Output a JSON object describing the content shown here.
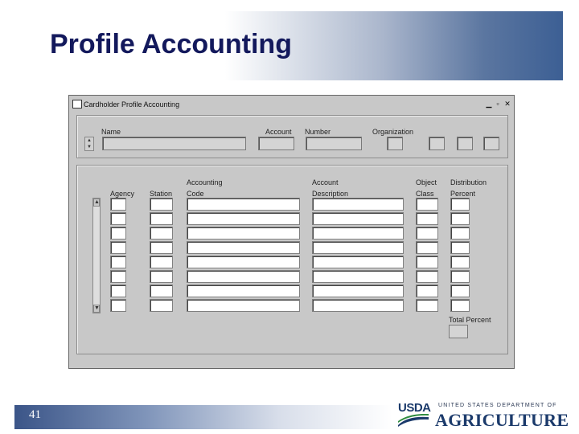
{
  "slide": {
    "title": "Profile Accounting",
    "page_number": "41",
    "footer": {
      "usda_mark": "USDA",
      "department": "UNITED STATES DEPARTMENT OF",
      "agriculture": "AGRICULTURE"
    }
  },
  "window": {
    "title": "Cardholder Profile Accounting",
    "controls": [
      "minimize",
      "maximize",
      "close"
    ]
  },
  "header_panel": {
    "labels": {
      "name": "Name",
      "account": "Account",
      "number": "Number",
      "organization": "Organization"
    },
    "values": {
      "name": "",
      "account": "",
      "number": "",
      "organization": ""
    }
  },
  "grid_panel": {
    "columns": [
      {
        "key": "agency",
        "label": "Agency"
      },
      {
        "key": "station",
        "label": "Station"
      },
      {
        "key": "accounting_code",
        "label_1": "Accounting",
        "label_2": "Code"
      },
      {
        "key": "account_description",
        "label_1": "Account",
        "label_2": "Description"
      },
      {
        "key": "object_class",
        "label_1": "Object",
        "label_2": "Class"
      },
      {
        "key": "distribution_percent",
        "label_1": "Distribution",
        "label_2": "Percent"
      }
    ],
    "rows": [
      [
        "",
        "",
        "",
        "",
        "",
        ""
      ],
      [
        "",
        "",
        "",
        "",
        "",
        ""
      ],
      [
        "",
        "",
        "",
        "",
        "",
        ""
      ],
      [
        "",
        "",
        "",
        "",
        "",
        ""
      ],
      [
        "",
        "",
        "",
        "",
        "",
        ""
      ],
      [
        "",
        "",
        "",
        "",
        "",
        ""
      ],
      [
        "",
        "",
        "",
        "",
        "",
        ""
      ],
      [
        "",
        "",
        "",
        "",
        "",
        ""
      ]
    ],
    "total_percent_label": "Total Percent",
    "total_percent_value": ""
  },
  "colors": {
    "title_text": "#13195c",
    "title_band_end": "#3c5f94",
    "window_bg": "#c8c8c8"
  }
}
